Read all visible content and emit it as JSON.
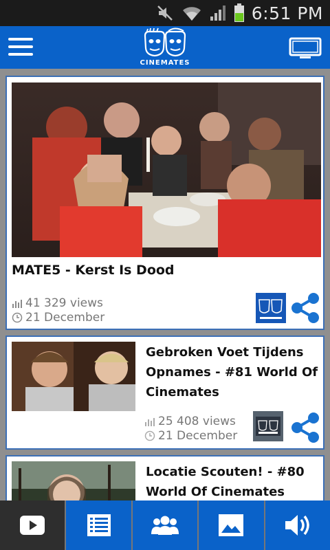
{
  "status_bar": {
    "time": "6:51 PM",
    "icons": [
      "mute-icon",
      "wifi-icon",
      "signal-icon",
      "battery-icon"
    ]
  },
  "header": {
    "logo_text": "CINEMATES",
    "left_icon": "hamburger-menu-icon",
    "right_icon": "tv-cast-icon"
  },
  "feed": {
    "videos": [
      {
        "title": "MATE5 - Kerst Is Dood",
        "views": "41 329 views",
        "date": "21 December",
        "channel_icon": "cinemates-logo-icon",
        "share_icon": "share-icon"
      },
      {
        "title": "Gebroken Voet Tijdens Opnames - #81 World Of Cinemates",
        "views": "25 408 views",
        "date": "21 December",
        "channel_icon": "world-of-cinemates-icon",
        "share_icon": "share-icon"
      },
      {
        "title": "Locatie Scouten! - #80 World Of Cinemates"
      }
    ]
  },
  "bottom_nav": {
    "items": [
      {
        "icon": "play-video-icon",
        "active": true
      },
      {
        "icon": "list-icon",
        "active": false
      },
      {
        "icon": "people-icon",
        "active": false
      },
      {
        "icon": "image-icon",
        "active": false
      },
      {
        "icon": "speaker-icon",
        "active": false
      }
    ]
  },
  "colors": {
    "brand_blue": "#0a62c9",
    "status_bar": "#1b1b1b",
    "card_border": "#3b6fb6",
    "share_blue": "#1a73d1"
  }
}
